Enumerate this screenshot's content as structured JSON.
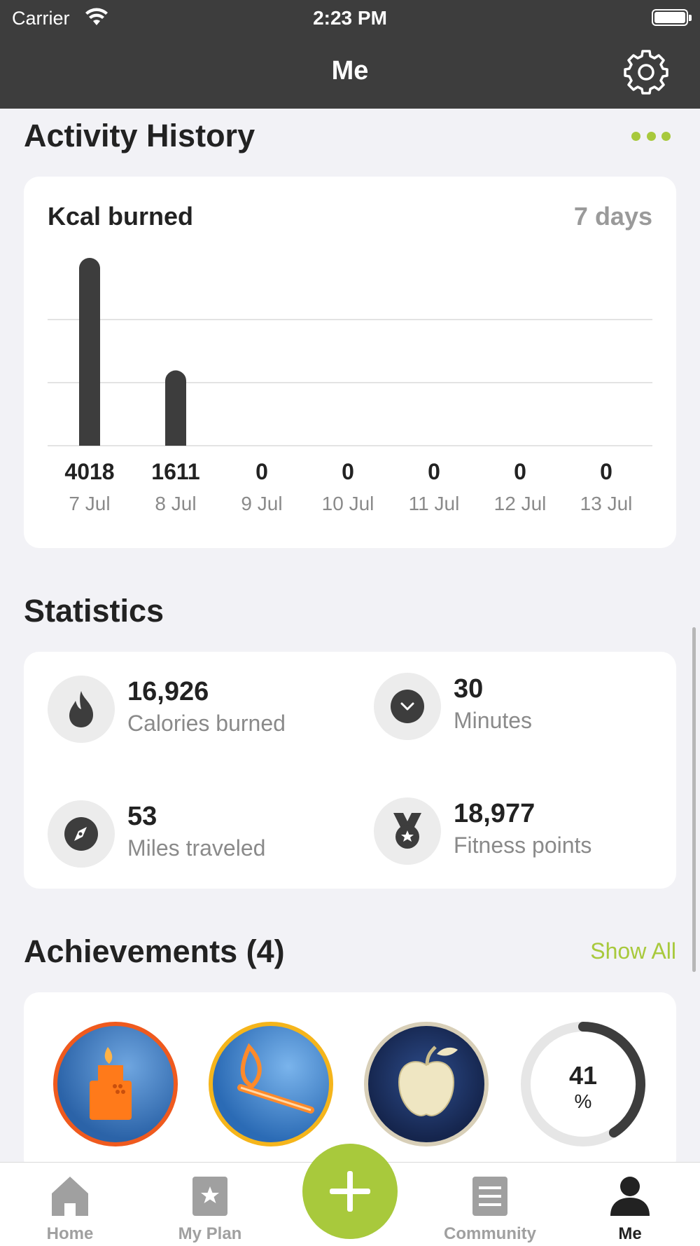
{
  "status_bar": {
    "carrier": "Carrier",
    "time": "2:23 PM"
  },
  "nav": {
    "title": "Me"
  },
  "activity": {
    "title": "Activity History",
    "card_title": "Kcal burned",
    "range": "7 days"
  },
  "chart_data": {
    "type": "bar",
    "categories": [
      "7 Jul",
      "8 Jul",
      "9 Jul",
      "10 Jul",
      "11 Jul",
      "12 Jul",
      "13 Jul"
    ],
    "values": [
      4018,
      1611,
      0,
      0,
      0,
      0,
      0
    ],
    "title": "Kcal burned",
    "xlabel": "",
    "ylabel": "",
    "grid": true,
    "ylim": [
      0,
      4018
    ]
  },
  "statistics": {
    "title": "Statistics",
    "items": [
      {
        "value": "16,926",
        "label": "Calories burned",
        "icon": "flame-icon"
      },
      {
        "value": "30",
        "label": "Minutes",
        "icon": "clock-icon"
      },
      {
        "value": "53",
        "label": "Miles traveled",
        "icon": "compass-icon"
      },
      {
        "value": "18,977",
        "label": "Fitness points",
        "icon": "medal-icon"
      }
    ]
  },
  "achievements": {
    "title": "Achievements (4)",
    "show_all": "Show All",
    "progress_value": "41",
    "progress_unit": "%",
    "progress_fraction": 0.41
  },
  "tabs": [
    {
      "label": "Home",
      "icon": "home-icon"
    },
    {
      "label": "My Plan",
      "icon": "star-card-icon"
    },
    {
      "label": "Community",
      "icon": "book-icon"
    },
    {
      "label": "Me",
      "icon": "person-icon"
    }
  ],
  "colors": {
    "accent": "#a8c93c",
    "header": "#3d3d3d",
    "bar": "#3d3d3d"
  }
}
